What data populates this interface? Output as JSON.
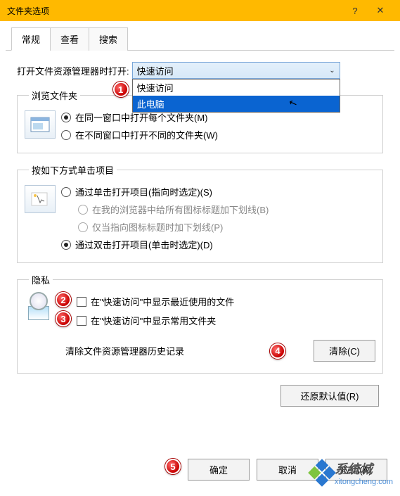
{
  "titlebar": {
    "title": "文件夹选项"
  },
  "tabs": {
    "t0": "常规",
    "t1": "查看",
    "t2": "搜索"
  },
  "open_with": {
    "label": "打开文件资源管理器时打开:",
    "selected": "快速访问",
    "options": {
      "o0": "快速访问",
      "o1": "此电脑"
    }
  },
  "browse": {
    "legend": "浏览文件夹",
    "r_same": "在同一窗口中打开每个文件夹(M)",
    "r_diff": "在不同窗口中打开不同的文件夹(W)"
  },
  "click": {
    "legend": "按如下方式单击项目",
    "r_single": "通过单击打开项目(指向时选定)(S)",
    "r_sub1": "在我的浏览器中给所有图标标题加下划线(B)",
    "r_sub2": "仅当指向图标标题时加下划线(P)",
    "r_double": "通过双击打开项目(单击时选定)(D)"
  },
  "privacy": {
    "legend": "隐私",
    "c_recent": "在\"快速访问\"中显示最近使用的文件",
    "c_freq": "在\"快速访问\"中显示常用文件夹",
    "clear_label": "清除文件资源管理器历史记录",
    "clear_btn": "清除(C)"
  },
  "restore_btn": "还原默认值(R)",
  "buttons": {
    "ok": "确定",
    "cancel": "取消",
    "apply": "应用(A)"
  },
  "markers": {
    "m1": "1",
    "m2": "2",
    "m3": "3",
    "m4": "4",
    "m5": "5"
  },
  "watermark": {
    "cn": "系统城",
    "url": "xitongcheng.com"
  }
}
